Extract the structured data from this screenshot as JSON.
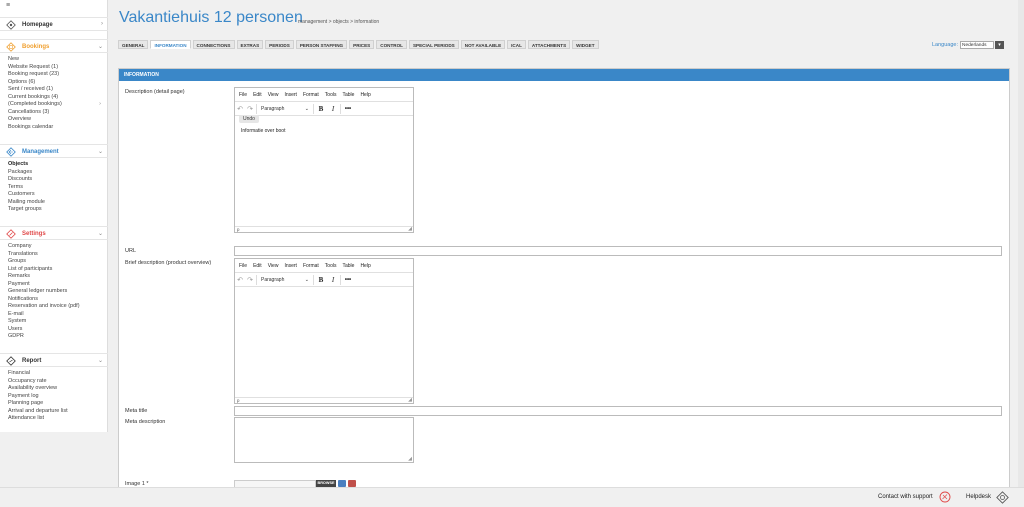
{
  "sidebar": {
    "menu_icon": "hamburger-icon",
    "groups": [
      {
        "title": "Homepage",
        "icon": "home-icon",
        "color": "#555555",
        "items": []
      },
      {
        "title": "Bookings",
        "icon": "bookings-icon",
        "color": "#f0a030",
        "items": [
          "New",
          "Website Request (1)",
          "Booking request (23)",
          "Options (6)",
          "Sent / received (1)",
          "Current bookings (4)",
          "(Completed bookings)",
          "Cancellations (3)",
          "Overview",
          "Bookings calendar"
        ]
      },
      {
        "title": "Management",
        "icon": "management-icon",
        "color": "#3a87c8",
        "items": [
          "Objects",
          "Packages",
          "Discounts",
          "Terms",
          "Customers",
          "Mailing module",
          "Target groups"
        ]
      },
      {
        "title": "Settings",
        "icon": "settings-icon",
        "color": "#e04848",
        "items": [
          "Company",
          "Translations",
          "Groups",
          "List of participants",
          "Remarks",
          "Payment",
          "General ledger numbers",
          "Notifications",
          "Reservation and invoice (pdf)",
          "E-mail",
          "System",
          "Users",
          "GDPR"
        ]
      },
      {
        "title": "Report",
        "icon": "report-icon",
        "color": "#333333",
        "items": [
          "Financial",
          "Occupancy rate",
          "Availability overview",
          "Payment log",
          "Planning page",
          "Arrival and departure list",
          "Attendance list"
        ]
      }
    ]
  },
  "header": {
    "title": "Vakantiehuis 12 personen",
    "breadcrumb": "management > objects > information"
  },
  "tabs": [
    "GENERAL",
    "INFORMATION",
    "CONNECTIONS",
    "EXTRAS",
    "PERIODS",
    "PERSON STAFFING",
    "PRICES",
    "CONTROL",
    "SPECIAL PERIODS",
    "NOT AVAILABLE",
    "ICAL",
    "ATTACHMENTS",
    "WIDGET"
  ],
  "active_tab": "INFORMATION",
  "language": {
    "label": "Language:",
    "value": "Nederlands"
  },
  "panel": {
    "header": "INFORMATION",
    "fields": {
      "description_label": "Description (detail page)",
      "url_label": "URL",
      "brief_label": "Brief description (product overview)",
      "meta_title_label": "Meta title",
      "meta_description_label": "Meta description",
      "image1_label": "Image 1 *"
    },
    "editor": {
      "menus": [
        "File",
        "Edit",
        "View",
        "Insert",
        "Format",
        "Tools",
        "Table",
        "Help"
      ],
      "format_select": "Paragraph",
      "bold": "B",
      "italic": "I",
      "more": "•••",
      "status_path": "p",
      "tooltip": "Undo"
    },
    "description_content": "Informatie over boot",
    "browse_label": "BROWSE"
  },
  "footer": {
    "support": "Contact with support",
    "helpdesk": "Helpdesk"
  },
  "colors": {
    "accent": "#3a87c8",
    "bookings": "#f0a030",
    "settings": "#e04848"
  }
}
